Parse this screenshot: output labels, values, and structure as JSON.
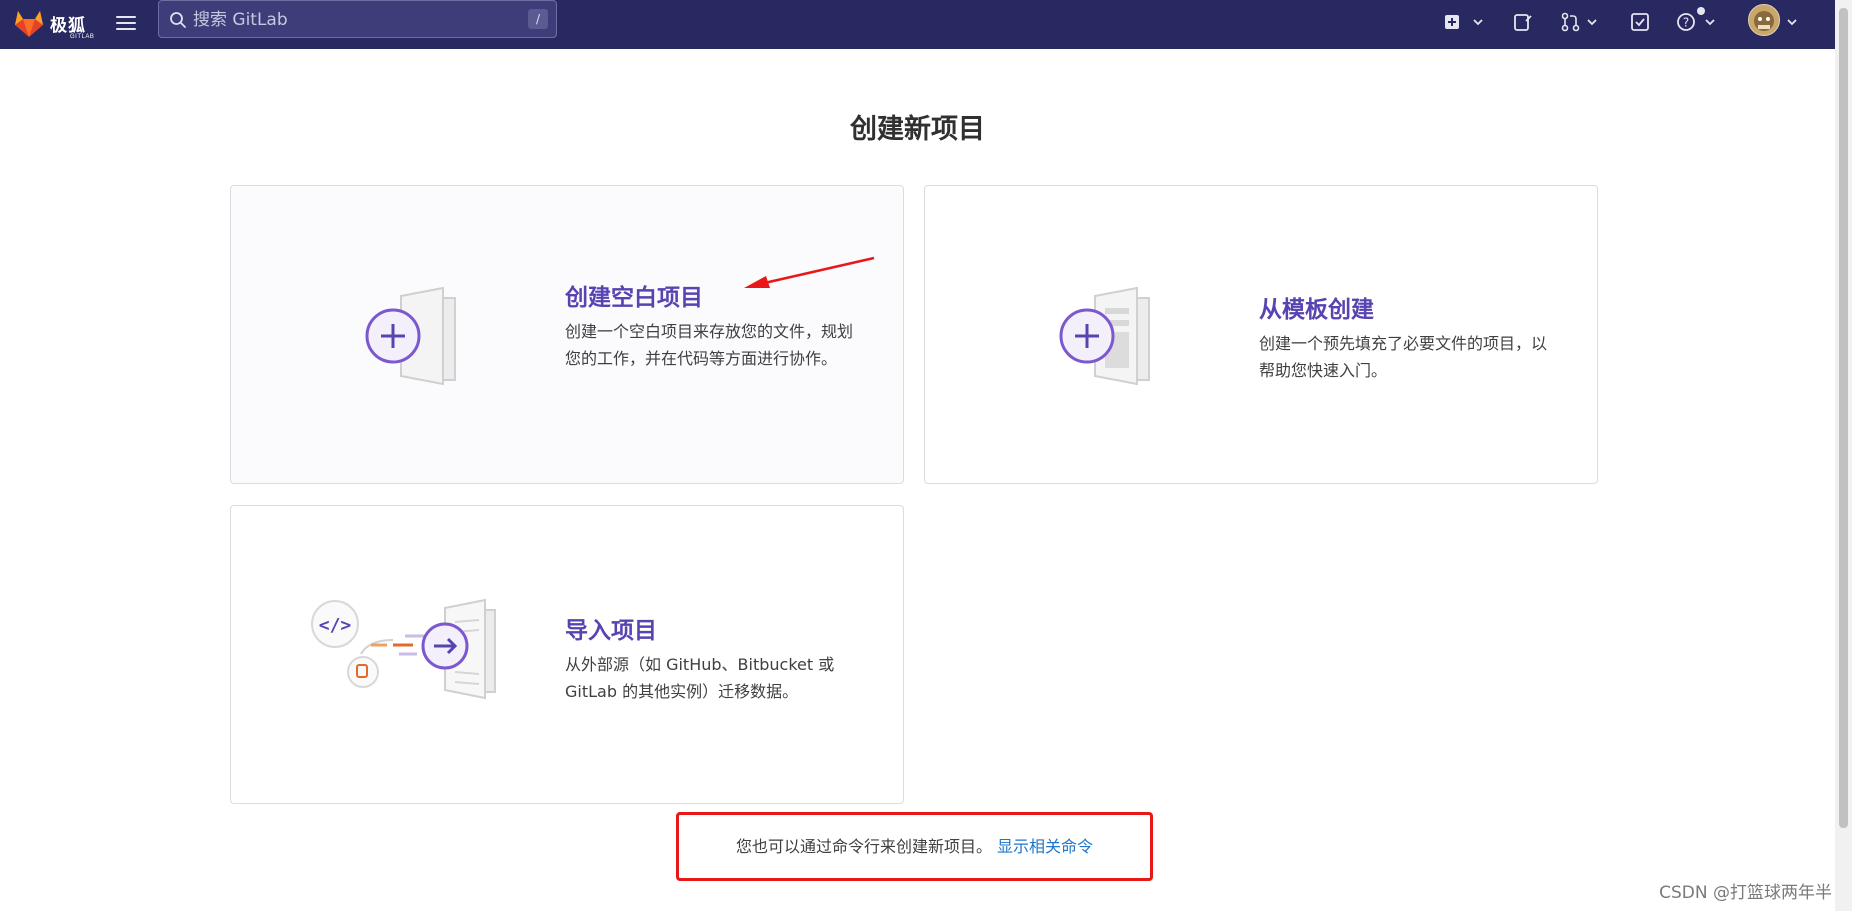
{
  "app": {
    "brand": "极狐",
    "brand_sub": "GITLAB"
  },
  "search": {
    "placeholder": "搜索 GitLab",
    "shortcut": "/"
  },
  "nav_icons": [
    "new-item-icon",
    "issues-icon",
    "merge-requests-icon",
    "todos-icon",
    "help-icon",
    "avatar"
  ],
  "page": {
    "title": "创建新项目"
  },
  "cards": [
    {
      "title": "创建空白项目",
      "desc": "创建一个空白项目来存放您的文件，规划您的工作，并在代码等方面进行协作。"
    },
    {
      "title": "从模板创建",
      "desc": "创建一个预先填充了必要文件的项目，以帮助您快速入门。"
    },
    {
      "title": "导入项目",
      "desc": "从外部源（如 GitHub、Bitbucket 或 GitLab 的其他实例）迁移数据。"
    }
  ],
  "hint": {
    "text": "您也可以通过命令行来创建新项目。",
    "link": "显示相关命令"
  },
  "watermark": "CSDN @打篮球两年半",
  "colors": {
    "nav_bg": "#292961",
    "accent": "#5943b1",
    "link": "#1f75cb",
    "annotation": "#e81818"
  }
}
